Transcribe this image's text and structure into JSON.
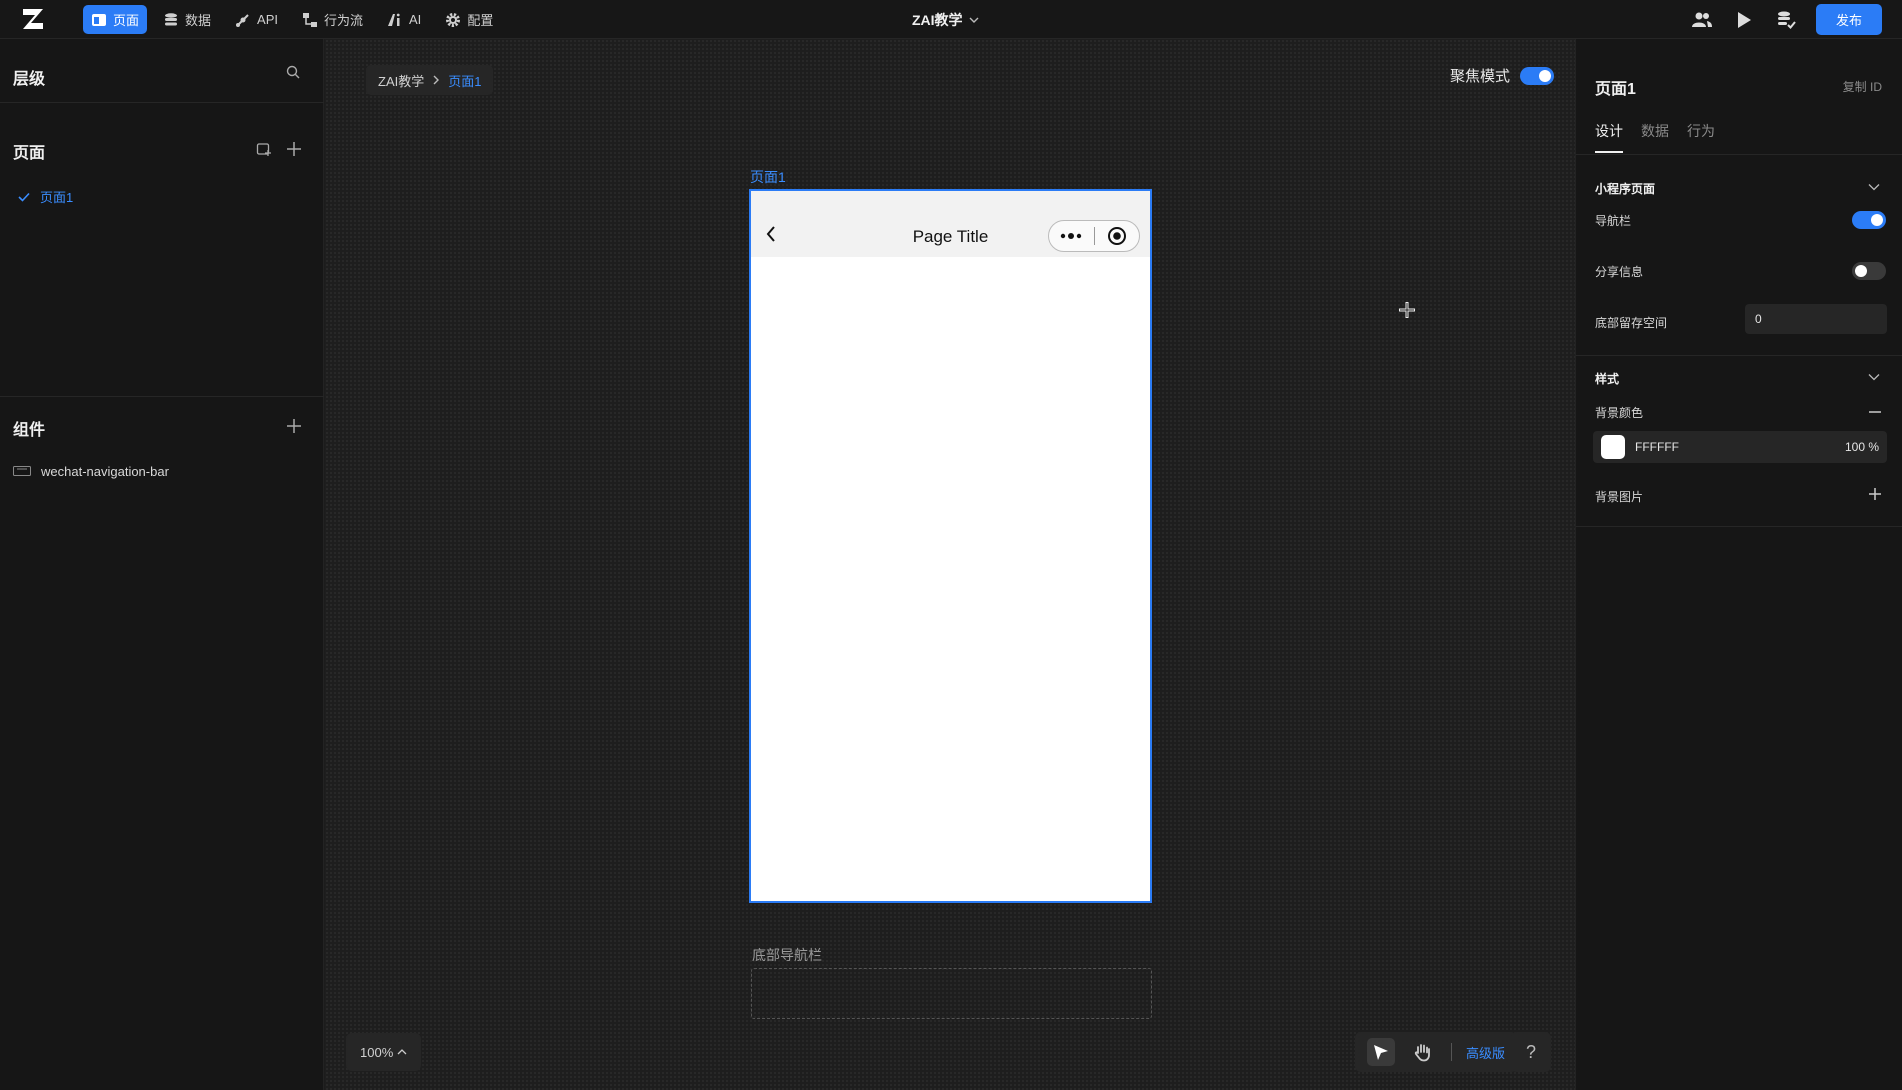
{
  "topbar": {
    "nav": [
      {
        "label": "页面",
        "icon": "page-icon",
        "active": true
      },
      {
        "label": "数据",
        "icon": "database-icon"
      },
      {
        "label": "API",
        "icon": "api-icon"
      },
      {
        "label": "行为流",
        "icon": "flow-icon"
      },
      {
        "label": "AI",
        "icon": "ai-icon"
      },
      {
        "label": "配置",
        "icon": "gear-icon"
      }
    ],
    "project": "ZAI教学",
    "publish": "发布",
    "accent": "#2b7cf6"
  },
  "left": {
    "layers_title": "层级",
    "pages_title": "页面",
    "pages": [
      {
        "label": "页面1"
      }
    ],
    "components_title": "组件",
    "components": [
      {
        "label": "wechat-navigation-bar"
      }
    ]
  },
  "canvas": {
    "breadcrumb": {
      "root": "ZAI教学",
      "current": "页面1"
    },
    "focus_mode": "聚焦模式",
    "frame_label": "页面1",
    "phone_title": "Page Title",
    "bottom_nav_label": "底部导航栏",
    "zoom": "100%",
    "advanced": "高级版",
    "help": "?"
  },
  "right": {
    "title": "页面1",
    "copy_id": "复制 ID",
    "tabs": [
      {
        "label": "设计",
        "active": true
      },
      {
        "label": "数据"
      },
      {
        "label": "行为"
      }
    ],
    "section_miniprogram": "小程序页面",
    "nav_bar_label": "导航栏",
    "share_label": "分享信息",
    "bottom_space_label": "底部留存空间",
    "bottom_space_value": "0",
    "section_style": "样式",
    "bg_color_label": "背景颜色",
    "bg_color_hex": "FFFFFF",
    "bg_color_opacity": "100 %",
    "bg_image_label": "背景图片"
  }
}
